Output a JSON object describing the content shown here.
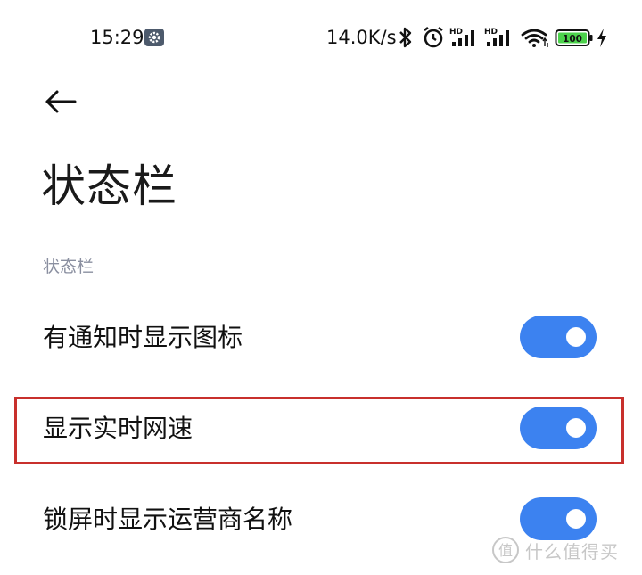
{
  "status_bar": {
    "time": "15:29",
    "network_speed": "14.0K/s",
    "signal_badge_1": "HD",
    "signal_badge_2": "HD",
    "battery_level": "100",
    "icons": [
      "settings-gear-icon",
      "bluetooth-icon",
      "alarm-icon",
      "cellular-signal-icon",
      "wifi-icon",
      "battery-icon",
      "charging-icon"
    ]
  },
  "header": {
    "title": "状态栏"
  },
  "section": {
    "title": "状态栏"
  },
  "settings": [
    {
      "label": "有通知时显示图标",
      "enabled": true
    },
    {
      "label": "显示实时网速",
      "enabled": true,
      "highlighted": true
    },
    {
      "label": "锁屏时显示运营商名称",
      "enabled": true
    }
  ],
  "colors": {
    "toggle_on": "#3c82f0",
    "highlight": "#c8302c",
    "section_text": "#8a8fa0",
    "battery_fill": "#4cd24c"
  },
  "watermark": {
    "text": "什么值得买"
  }
}
